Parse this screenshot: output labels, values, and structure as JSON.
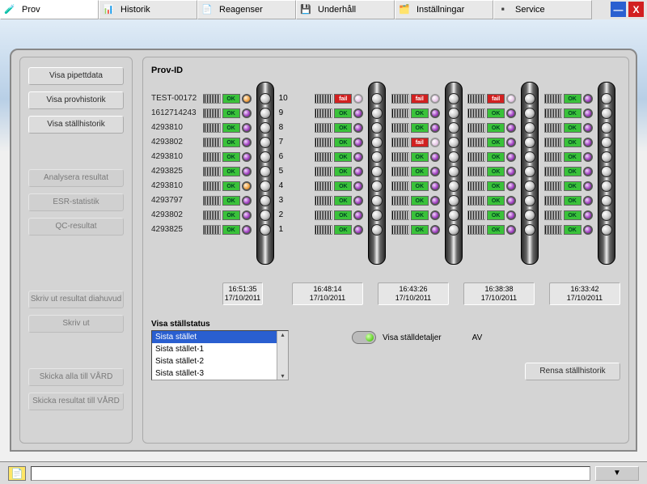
{
  "tabs": [
    "Prov",
    "Historik",
    "Reagenser",
    "Underhåll",
    "Inställningar",
    "Service"
  ],
  "active_tab": 0,
  "left_buttons": {
    "a": "Visa pipettdata",
    "b": "Visa provhistorik",
    "c": "Visa ställhistorik",
    "d": "Analysera resultat",
    "e": "ESR-statistik",
    "f": "QC-resultat",
    "g": "Skriv ut resultat diahuvud",
    "h": "Skriv ut",
    "i": "Skicka alla till VÅRD",
    "j": "Skicka resultat till VÅRD"
  },
  "prov_id_label": "Prov-ID",
  "sample_ids": [
    "TEST-00172",
    "1612714243",
    "4293810",
    "4293802",
    "4293810",
    "4293825",
    "4293810",
    "4293797",
    "4293802",
    "4293825"
  ],
  "positions": [
    "10",
    "9",
    "8",
    "7",
    "6",
    "5",
    "4",
    "3",
    "2",
    "1"
  ],
  "rack0_ts_time": "16:51:35",
  "rack0_ts_date": "17/10/2011",
  "racks_ts": [
    {
      "time": "16:48:14",
      "date": "17/10/2011"
    },
    {
      "time": "16:43:26",
      "date": "17/10/2011"
    },
    {
      "time": "16:38:38",
      "date": "17/10/2011"
    },
    {
      "time": "16:33:42",
      "date": "17/10/2011"
    }
  ],
  "rack0": [
    {
      "st": "ok",
      "led": "orange"
    },
    {
      "st": "ok",
      "led": "purple"
    },
    {
      "st": "ok",
      "led": "purple"
    },
    {
      "st": "ok",
      "led": "purple"
    },
    {
      "st": "ok",
      "led": "purple"
    },
    {
      "st": "ok",
      "led": "purple"
    },
    {
      "st": "ok",
      "led": "orange"
    },
    {
      "st": "ok",
      "led": "purple"
    },
    {
      "st": "ok",
      "led": "purple"
    },
    {
      "st": "ok",
      "led": "purple"
    }
  ],
  "rack1": [
    {
      "st": "fail",
      "led": "pale"
    },
    {
      "st": "ok",
      "led": "purple"
    },
    {
      "st": "ok",
      "led": "purple"
    },
    {
      "st": "ok",
      "led": "purple"
    },
    {
      "st": "ok",
      "led": "purple"
    },
    {
      "st": "ok",
      "led": "purple"
    },
    {
      "st": "ok",
      "led": "purple"
    },
    {
      "st": "ok",
      "led": "purple"
    },
    {
      "st": "ok",
      "led": "purple"
    },
    {
      "st": "ok",
      "led": "purple"
    }
  ],
  "rack2": [
    {
      "st": "fail",
      "led": "pale"
    },
    {
      "st": "ok",
      "led": "purple"
    },
    {
      "st": "ok",
      "led": "purple"
    },
    {
      "st": "fail",
      "led": "pale"
    },
    {
      "st": "ok",
      "led": "purple"
    },
    {
      "st": "ok",
      "led": "purple"
    },
    {
      "st": "ok",
      "led": "purple"
    },
    {
      "st": "ok",
      "led": "purple"
    },
    {
      "st": "ok",
      "led": "purple"
    },
    {
      "st": "ok",
      "led": "purple"
    }
  ],
  "rack3": [
    {
      "st": "fail",
      "led": "pale"
    },
    {
      "st": "ok",
      "led": "purple"
    },
    {
      "st": "ok",
      "led": "purple"
    },
    {
      "st": "ok",
      "led": "purple"
    },
    {
      "st": "ok",
      "led": "purple"
    },
    {
      "st": "ok",
      "led": "purple"
    },
    {
      "st": "ok",
      "led": "purple"
    },
    {
      "st": "ok",
      "led": "purple"
    },
    {
      "st": "ok",
      "led": "purple"
    },
    {
      "st": "ok",
      "led": "purple"
    }
  ],
  "rack4": [
    {
      "st": "ok",
      "led": "purple"
    },
    {
      "st": "ok",
      "led": "purple"
    },
    {
      "st": "ok",
      "led": "purple"
    },
    {
      "st": "ok",
      "led": "purple"
    },
    {
      "st": "ok",
      "led": "purple"
    },
    {
      "st": "ok",
      "led": "purple"
    },
    {
      "st": "ok",
      "led": "purple"
    },
    {
      "st": "ok",
      "led": "purple"
    },
    {
      "st": "ok",
      "led": "purple"
    },
    {
      "st": "ok",
      "led": "purple"
    }
  ],
  "status_ok_label": "OK",
  "status_fail_label": "fail",
  "visa_stallstatus_label": "Visa ställstatus",
  "list_items": [
    "Sista stället",
    "Sista stället-1",
    "Sista stället-2",
    "Sista stället-3"
  ],
  "list_selected": 0,
  "toggle_label": "Visa ställdetaljer",
  "toggle_state": "AV",
  "rensa_label": "Rensa ställhistorik",
  "statusbar_msg": ""
}
